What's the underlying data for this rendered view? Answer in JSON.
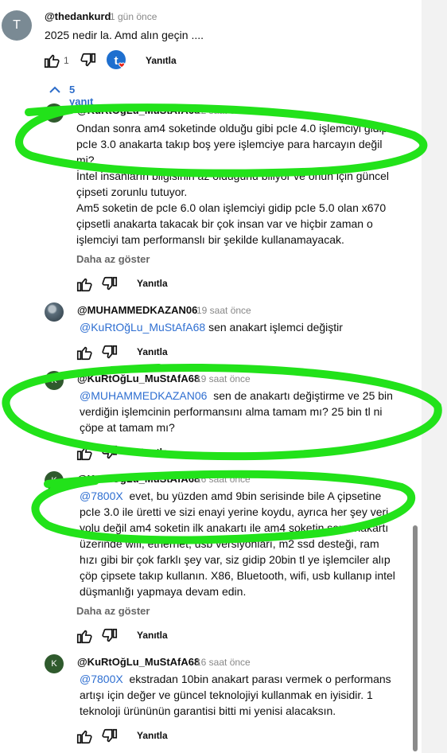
{
  "top_comment": {
    "avatar_letter": "T",
    "author": "@thedankurd",
    "time": "1 gün önce",
    "text": "2025 nedir la. Amd alın geçin ....",
    "like_count": "1",
    "reply_label": "Yanıtla"
  },
  "replies_toggle": "5 yanıt",
  "replies": [
    {
      "avatar_letter": "K",
      "author": "@KuRtOğLu_MuStAfA68",
      "time": "22 saat önce",
      "mention": "",
      "text": "Ondan sonra am4 soketinde olduğu gibi pcIe 4.0 işlemciyi gidip pcIe 3.0 anakarta takıp boş yere işlemciye para harcayın değil mi?\nİntel insanların bilgisinin az olduğunu biliyor ve onun için güncel çipseti zorunlu tutuyor.\nAm5 soketin de pcIe 6.0 olan işlemciyi gidip pcIe 5.0 olan x670 çipsetli anakarta takacak bir çok insan var ve hiçbir zaman o işlemciyi tam performanslı bir şekilde kullanamayacak.",
      "less": "Daha az göster",
      "reply_label": "Yanıtla"
    },
    {
      "avatar_letter": "",
      "author": "@MUHAMMEDKAZAN06",
      "time": "19 saat önce",
      "mention": "@KuRtOğLu_MuStAfA68",
      "text": "sen anakart işlemci değiştir",
      "less": "",
      "reply_label": "Yanıtla"
    },
    {
      "avatar_letter": "K",
      "author": "@KuRtOğLu_MuStAfA68",
      "time": "19 saat önce",
      "mention": "@MUHAMMEDKAZAN06",
      "text": "sen de anakartı değiştirme ve 25 bin verdiğin işlemcinin performansını alma tamam mı? 25 bin tl ni çöpe at tamam mı?",
      "less": "",
      "reply_label": "Yanıtla"
    },
    {
      "avatar_letter": "K",
      "author": "@KuRtOğLu_MuStAfA68",
      "time": "16 saat önce",
      "mention": "@7800X",
      "text": "evet, bu yüzden amd 9bin serisinde bile A çipsetine pcIe 3.0 ile üretti ve sizi enayi yerine koydu, ayrıca her şey veri yolu değil am4 soketin ilk anakartı ile am4 soketin son anakartı üzerinde wifi, ethernet, usb versiyonları, m2 ssd desteği, ram hızı gibi bir çok farklı şey var, siz gidip 20bin tl ye işlemciler alıp çöp çipsete takıp kullanın. X86, Bluetooth, wifi, usb kullanıp intel düşmanlığı yapmaya devam edin.",
      "less": "Daha az göster",
      "reply_label": "Yanıtla"
    },
    {
      "avatar_letter": "K",
      "author": "@KuRtOğLu_MuStAfA68",
      "time": "16 saat önce",
      "mention": "@7800X",
      "text": "ekstradan 10bin anakart parası vermek o performans artışı için değer ve güncel teknolojiyi kullanmak en iyisidir. 1 teknoloji ürününün garantisi bitti mi yenisi alacaksın.",
      "less": "",
      "reply_label": "Yanıtla"
    }
  ],
  "colors": {
    "highlight": "#22e21a",
    "mention": "#2f6fd1",
    "creator_badge": "#1e6fcf"
  }
}
